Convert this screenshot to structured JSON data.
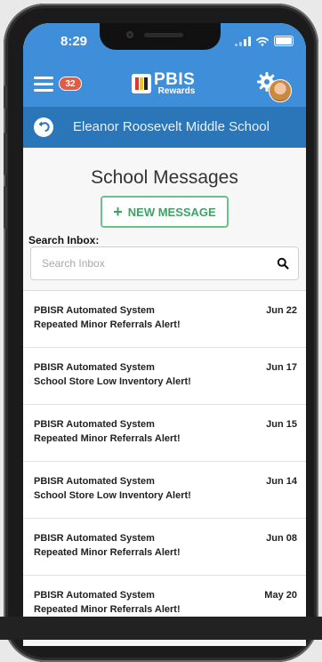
{
  "status_bar": {
    "time": "8:29"
  },
  "app_bar": {
    "notification_count": "32",
    "logo_title": "PBIS",
    "logo_subtitle": "Rewards",
    "brand_colors": {
      "primary": "#3f8ed9",
      "secondary": "#2a76b8",
      "accent_green": "#3ca365"
    }
  },
  "school_bar": {
    "school_name": "Eleanor Roosevelt Middle School"
  },
  "page": {
    "title": "School Messages",
    "new_message_label": "NEW MESSAGE",
    "search_label": "Search Inbox:",
    "search_placeholder": "Search Inbox"
  },
  "messages": [
    {
      "sender": "PBISR Automated System",
      "subject": "Repeated Minor Referrals Alert!",
      "date": "Jun 22"
    },
    {
      "sender": "PBISR Automated System",
      "subject": "School Store Low Inventory Alert!",
      "date": "Jun 17"
    },
    {
      "sender": "PBISR Automated System",
      "subject": "Repeated Minor Referrals Alert!",
      "date": "Jun 15"
    },
    {
      "sender": "PBISR Automated System",
      "subject": "School Store Low Inventory Alert!",
      "date": "Jun 14"
    },
    {
      "sender": "PBISR Automated System",
      "subject": "Repeated Minor Referrals Alert!",
      "date": "Jun 08"
    },
    {
      "sender": "PBISR Automated System",
      "subject": "Repeated Minor Referrals Alert!",
      "date": "May 20"
    }
  ],
  "icons": [
    "hamburger-menu-icon",
    "gear-icon",
    "back-arrow-icon",
    "search-icon",
    "plus-icon",
    "signal-icon",
    "wifi-icon",
    "battery-icon"
  ]
}
